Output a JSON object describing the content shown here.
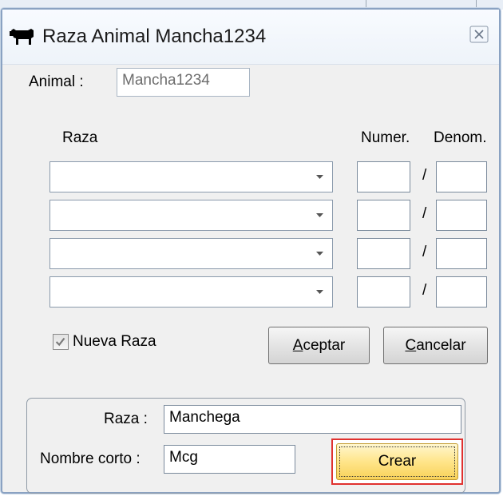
{
  "window": {
    "title": "Raza Animal Mancha1234",
    "icon": "cow-icon",
    "close_icon": "close-icon"
  },
  "animal": {
    "label": "Animal :",
    "value": "Mancha1234"
  },
  "breeds": {
    "header_raza": "Raza",
    "header_numer": "Numer.",
    "header_denom": "Denom.",
    "separator": "/",
    "rows": [
      {
        "raza": "",
        "numer": "",
        "denom": ""
      },
      {
        "raza": "",
        "numer": "",
        "denom": ""
      },
      {
        "raza": "",
        "numer": "",
        "denom": ""
      },
      {
        "raza": "",
        "numer": "",
        "denom": ""
      }
    ]
  },
  "nueva_raza": {
    "label": "Nueva Raza",
    "checked": true
  },
  "buttons": {
    "aceptar_accel": "A",
    "aceptar_rest": "ceptar",
    "cancelar_accel": "C",
    "cancelar_rest": "ancelar",
    "crear": "Crear"
  },
  "new_breed": {
    "raza_label": "Raza :",
    "raza_value": "Manchega",
    "nombre_corto_label": "Nombre corto :",
    "nombre_corto_value": "Mcg"
  }
}
